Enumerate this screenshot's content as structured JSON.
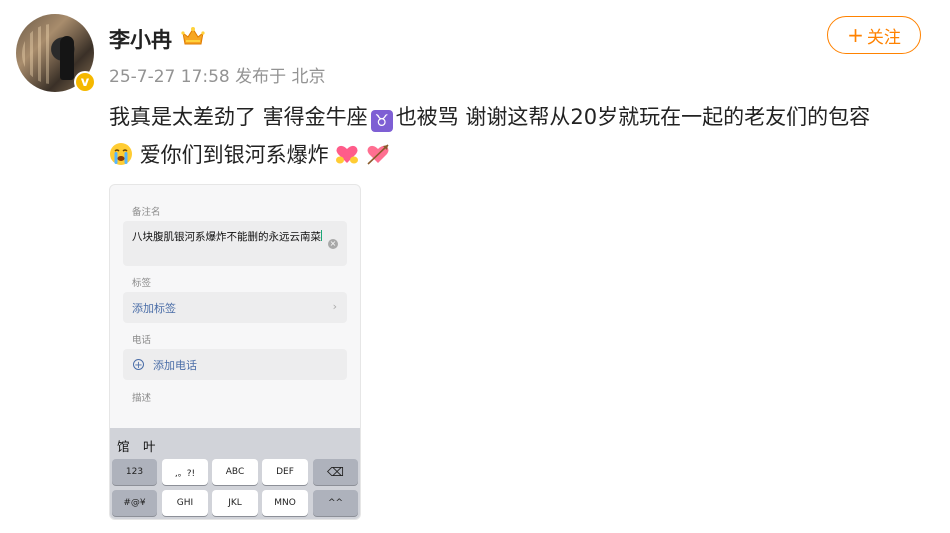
{
  "user": {
    "name": "李小冉",
    "meta": "25-7-27 17:58 发布于 北京"
  },
  "follow_button": {
    "plus": "+",
    "label": "关注"
  },
  "post": {
    "line1_a": "我真是太差劲了 害得金牛座",
    "taurus_symbol": "♉",
    "line1_b": "也被骂 谢谢这帮从20岁就玩在一起的老友们的包容",
    "line2": "爱你们到银河系爆炸"
  },
  "icons": [
    "avatar",
    "verified-badge-icon",
    "crown-icon",
    "taurus-icon",
    "crying-face-icon",
    "heart-hands-icon",
    "heart-arrow-icon",
    "clear-icon",
    "chevron-right-icon",
    "plus-circle-icon",
    "backspace-icon"
  ],
  "colors": {
    "accent": "#ff8200",
    "verified": "#f5b800",
    "link": "#4b6ea8"
  },
  "screenshot": {
    "note_label": "备注名",
    "note_value": "八块腹肌银河系爆炸不能删的永远云南菜",
    "tag_label": "标签",
    "add_tag": "添加标签",
    "phone_label": "电话",
    "add_phone": "添加电话",
    "desc_label": "描述",
    "candidates": [
      "馆",
      "叶"
    ],
    "keys_row1": [
      "123",
      ",。?!",
      "ABC",
      "DEF",
      "⌫"
    ],
    "keys_row2": [
      "#@¥",
      "GHI",
      "JKL",
      "MNO",
      "^^"
    ]
  }
}
